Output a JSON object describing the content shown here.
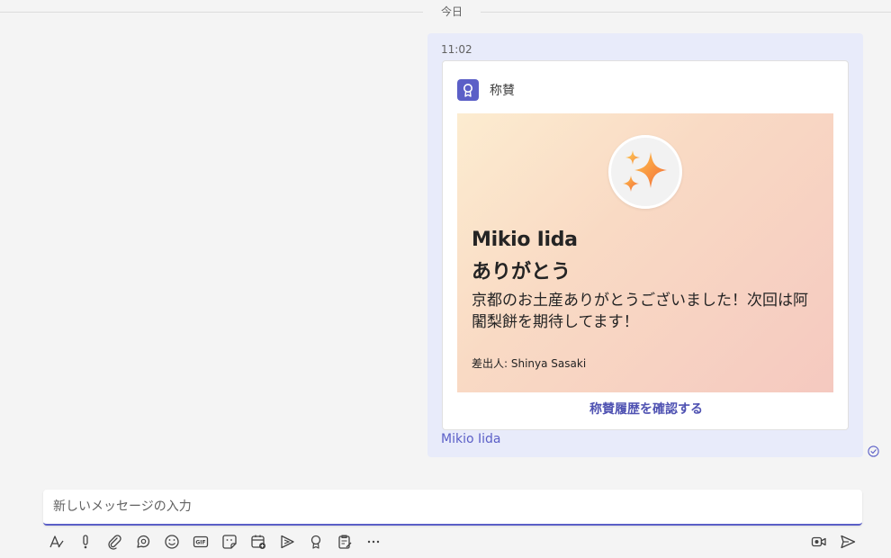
{
  "divider": {
    "date": "今日"
  },
  "message": {
    "time": "11:02",
    "card": {
      "title": "称賛",
      "recipient": "Mikio Iida",
      "thanks": "ありがとう",
      "body": "京都のお土産ありがとうございました！次回は阿闍梨餅を期待してます！",
      "from": "差出人: Shinya Sasaki",
      "link": "称賛履歴を確認する"
    },
    "mention": "Mikio Iida"
  },
  "compose": {
    "placeholder": "新しいメッセージの入力"
  },
  "toolbar": {
    "icons": [
      "format-icon",
      "important-icon",
      "attach-icon",
      "loop-icon",
      "emoji-icon",
      "gif-icon",
      "sticker-icon",
      "schedule-meeting-icon",
      "stream-icon",
      "praise-icon",
      "approvals-icon",
      "more-icon",
      "video-clip-icon",
      "send-icon"
    ]
  },
  "colors": {
    "accent": "#5b5fc7",
    "bubble": "#e8ebfa",
    "link": "#4f52b2"
  }
}
